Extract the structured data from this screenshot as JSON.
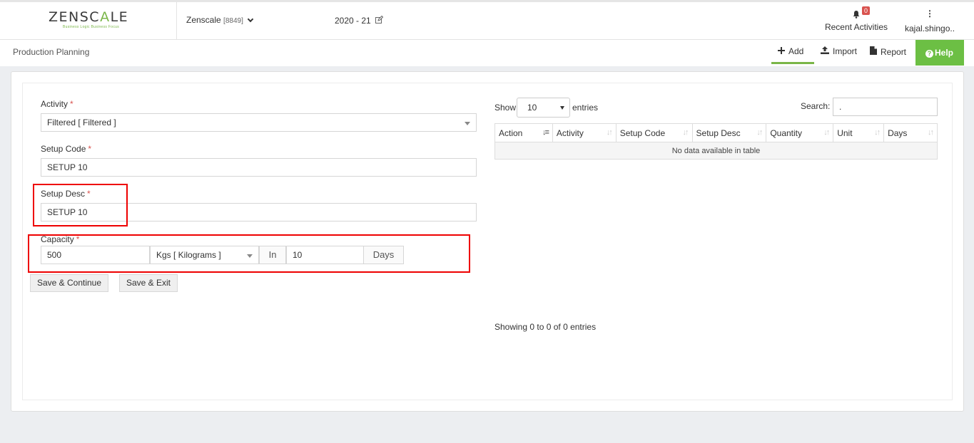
{
  "header": {
    "logo_text_1": "ZENSC",
    "logo_text_2": "A",
    "logo_text_3": "LE",
    "logo_tagline": "Business Logic Business Focus",
    "company": "Zenscale",
    "company_code": "[8849]",
    "fiscal_year": "2020 - 21",
    "notification_count": "0",
    "recent_activities": "Recent Activities",
    "user_menu_dots": "⋮",
    "user": "kajal.shingo.."
  },
  "subheader": {
    "page_title": "Production Planning",
    "add": "Add",
    "import": "Import",
    "report": "Report",
    "help": "Help"
  },
  "form": {
    "activity_label": "Activity",
    "activity_value": "Filtered [ Filtered ]",
    "setup_code_label": "Setup Code",
    "setup_code_value": "SETUP 10",
    "setup_desc_label": "Setup Desc",
    "setup_desc_value": "SETUP 10",
    "capacity_label": "Capacity",
    "capacity_value": "500",
    "capacity_unit": "Kgs [ Kilograms ]",
    "in_label": "In",
    "days_value": "10",
    "days_label": "Days",
    "required_mark": "*",
    "save_continue": "Save & Continue",
    "save_exit": "Save & Exit"
  },
  "table": {
    "show_label": "Show",
    "page_length": "10",
    "entries_label": "entries",
    "search_label": "Search:",
    "search_value": ".",
    "columns": [
      "Action",
      "Activity",
      "Setup Code",
      "Setup Desc",
      "Quantity",
      "Unit",
      "Days"
    ],
    "empty_message": "No data available in table",
    "info": "Showing 0 to 0 of 0 entries"
  },
  "colors": {
    "brand_green": "#6cbf44",
    "required_red": "#d9534f",
    "highlight_red": "#ee0000"
  }
}
